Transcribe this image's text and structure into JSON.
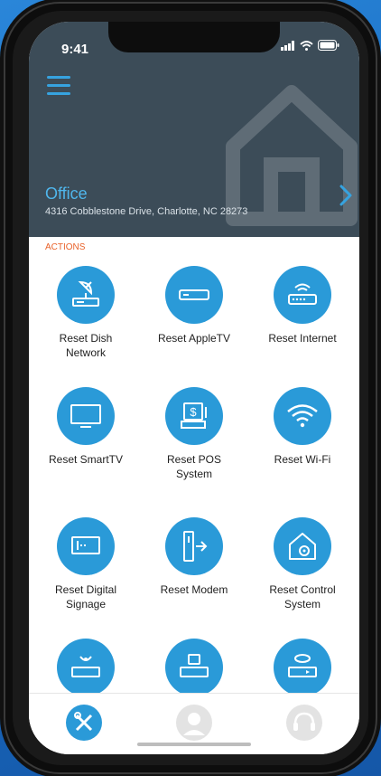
{
  "status_bar": {
    "time": "9:41"
  },
  "header": {
    "location_name": "Office",
    "location_address": "4316 Cobblestone Drive, Charlotte, NC 28273"
  },
  "actions": {
    "section_label": "ACTIONS",
    "items": [
      {
        "label": "Reset Dish Network",
        "icon": "satellite-dish-icon"
      },
      {
        "label": "Reset AppleTV",
        "icon": "appletv-box-icon"
      },
      {
        "label": "Reset Internet",
        "icon": "router-icon"
      },
      {
        "label": "Reset SmartTV",
        "icon": "tv-icon"
      },
      {
        "label": "Reset POS System",
        "icon": "pos-terminal-icon"
      },
      {
        "label": "Reset Wi-Fi",
        "icon": "wifi-icon"
      },
      {
        "label": "Reset Digital Signage",
        "icon": "signage-player-icon"
      },
      {
        "label": "Reset Modem",
        "icon": "modem-icon"
      },
      {
        "label": "Reset Control System",
        "icon": "home-gear-icon"
      },
      {
        "label": "",
        "icon": "camera-dvr-icon"
      },
      {
        "label": "",
        "icon": "network-switch-icon"
      },
      {
        "label": "",
        "icon": "media-player-icon"
      }
    ]
  },
  "tabbar": {
    "tabs": [
      {
        "icon": "tools-icon",
        "active": true
      },
      {
        "icon": "user-icon",
        "active": false
      },
      {
        "icon": "headset-icon",
        "active": false
      }
    ]
  },
  "colors": {
    "accent": "#2a9ad8",
    "header_bg": "#3c4c58",
    "section_label": "#e9622a"
  }
}
